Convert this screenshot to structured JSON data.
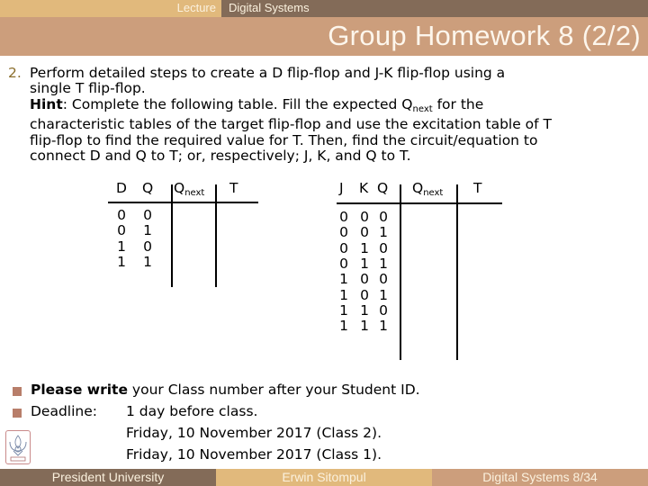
{
  "header": {
    "section_label": "Lecture",
    "course_name": "Digital Systems",
    "slide_title": "Group Homework 8 (2/2)"
  },
  "task": {
    "number": "2.",
    "line1": "Perform detailed steps to create a D flip-flop and J-K flip-flop using a",
    "line2": "single T flip-flop.",
    "hint_label": "Hint",
    "hint_pre": ": Complete the following table. Fill the expected Q",
    "hint_sub": "next",
    "hint_post": " for the",
    "line4": "characteristic tables of the target flip-flop and use the excitation table of T",
    "line5": "flip-flop to find the required value for T. Then, find the circuit/equation to",
    "line6": "connect D and Q to T; or, respectively; J, K, and Q to T."
  },
  "d_table": {
    "headers": {
      "d": "D",
      "q": "Q",
      "qnext": "Q",
      "qnext_sub": "next",
      "t": "T"
    },
    "rows": [
      {
        "d": "0",
        "q": "0",
        "qnext": "",
        "t": ""
      },
      {
        "d": "0",
        "q": "1",
        "qnext": "",
        "t": ""
      },
      {
        "d": "1",
        "q": "0",
        "qnext": "",
        "t": ""
      },
      {
        "d": "1",
        "q": "1",
        "qnext": "",
        "t": ""
      }
    ]
  },
  "jk_table": {
    "headers": {
      "j": "J",
      "k": "K",
      "q": "Q",
      "qnext": "Q",
      "qnext_sub": "next",
      "t": "T"
    },
    "rows": [
      {
        "j": "0",
        "k": "0",
        "q": "0",
        "qnext": "",
        "t": ""
      },
      {
        "j": "0",
        "k": "0",
        "q": "1",
        "qnext": "",
        "t": ""
      },
      {
        "j": "0",
        "k": "1",
        "q": "0",
        "qnext": "",
        "t": ""
      },
      {
        "j": "0",
        "k": "1",
        "q": "1",
        "qnext": "",
        "t": ""
      },
      {
        "j": "1",
        "k": "0",
        "q": "0",
        "qnext": "",
        "t": ""
      },
      {
        "j": "1",
        "k": "0",
        "q": "1",
        "qnext": "",
        "t": ""
      },
      {
        "j": "1",
        "k": "1",
        "q": "0",
        "qnext": "",
        "t": ""
      },
      {
        "j": "1",
        "k": "1",
        "q": "1",
        "qnext": "",
        "t": ""
      }
    ]
  },
  "notes": {
    "note1_bold": "Please write",
    "note1_rest": " your Class number after your Student ID.",
    "deadline_label": "Deadline:",
    "deadline_lines": [
      "1 day before class.",
      "Friday, 10 November 2017 (Class 2).",
      "Friday, 10 November 2017 (Class 1)."
    ]
  },
  "footer": {
    "institution": "President University",
    "author": "Erwin Sitompul",
    "page_info": "Digital Systems 8/34"
  },
  "colors": {
    "dark_brown": "#836b58",
    "tan": "#e1b97c",
    "salmon": "#cc9e7c",
    "bullet": "#b87e6a",
    "number": "#8a6d2b"
  }
}
